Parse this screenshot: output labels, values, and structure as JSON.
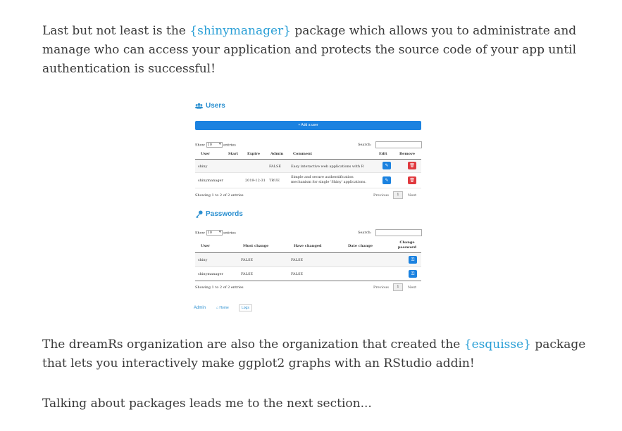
{
  "paragraphs": {
    "p1": {
      "before": "Last but not least is the ",
      "link": "{shinymanager}",
      "after": " package which allows you to administrate and manage who can access your application and protects the source code of your app until authentication is successful!"
    },
    "p2": {
      "before": "The dreamRs organization are also the organization that created the ",
      "link": "{esquisse}",
      "after": " package that lets you interactively make ggplot2 graphs with an RStudio addin!"
    },
    "p3": {
      "text": "Talking about packages leads me to the next section..."
    }
  },
  "screenshot": {
    "users": {
      "title": "Users",
      "add_button": "+ Add a user",
      "show_label": "Show",
      "show_value": "10",
      "entries_label": "entries",
      "search_label": "Search:",
      "columns": [
        "User",
        "Start",
        "Expire",
        "Admin",
        "Comment",
        "Edit",
        "Remove"
      ],
      "rows": [
        {
          "user": "shiny",
          "start": "",
          "expire": "",
          "admin": "FALSE",
          "comment": "Easy interactive web applications with R"
        },
        {
          "user": "shinymanager",
          "start": "",
          "expire": "2019-12-31",
          "admin": "TRUE",
          "comment": "Simple and secure authentification mechanism for single 'Shiny' applications."
        }
      ],
      "info": "Showing 1 to 2 of 2 entries",
      "prev": "Previous",
      "page": "1",
      "next": "Next"
    },
    "passwords": {
      "title": "Passwords",
      "show_label": "Show",
      "show_value": "10",
      "entries_label": "entries",
      "search_label": "Search:",
      "columns": [
        "User",
        "Must change",
        "Have changed",
        "Date change",
        "Change password"
      ],
      "rows": [
        {
          "user": "shiny",
          "must": "FALSE",
          "have": "FALSE",
          "date": ""
        },
        {
          "user": "shinymanager",
          "must": "FALSE",
          "have": "FALSE",
          "date": ""
        }
      ],
      "info": "Showing 1 to 2 of 2 entries",
      "prev": "Previous",
      "page": "1",
      "next": "Next"
    },
    "nav": {
      "admin": "Admin",
      "home": "Home",
      "logs": "Logs"
    }
  }
}
